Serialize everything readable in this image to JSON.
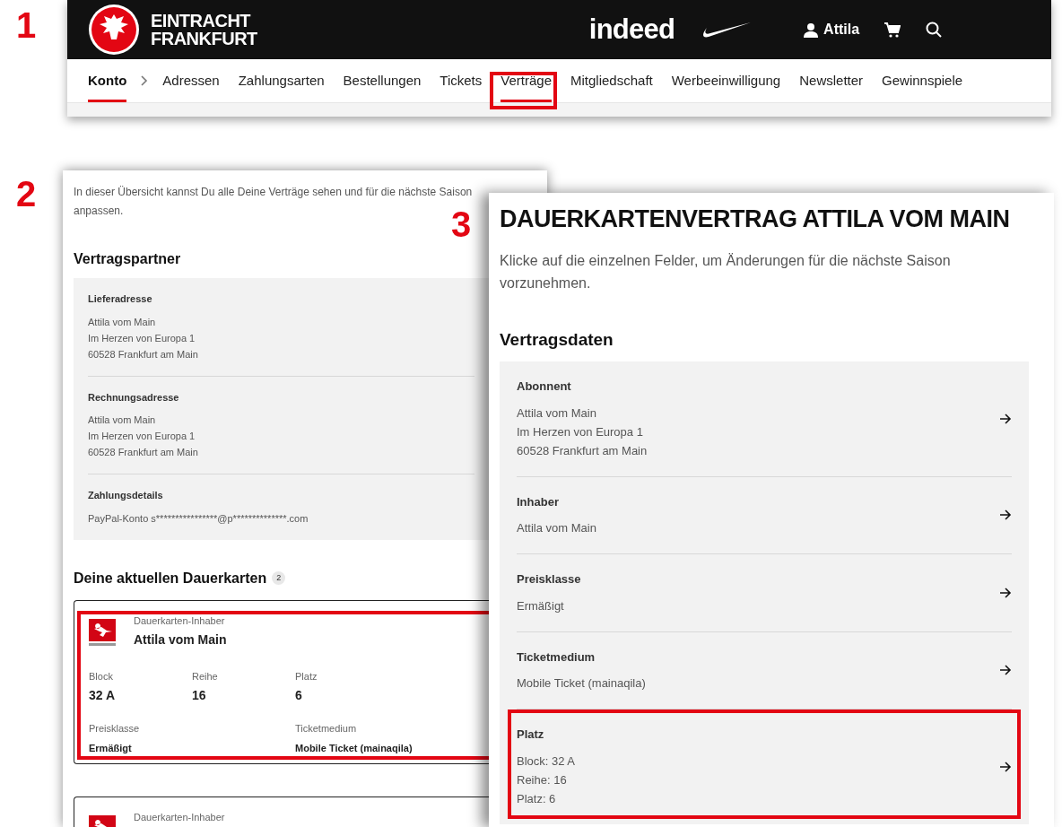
{
  "panel_1": {
    "step": "1",
    "header": {
      "brand": [
        "EINTRACHT",
        "FRANKFURT"
      ],
      "sponsor": "indeed",
      "user": "Attila"
    },
    "nav": {
      "root": "Konto",
      "items": [
        {
          "label": "Adressen",
          "selected": false,
          "highlighted": false
        },
        {
          "label": "Zahlungsarten",
          "selected": false,
          "highlighted": false
        },
        {
          "label": "Bestellungen",
          "selected": false,
          "highlighted": false
        },
        {
          "label": "Tickets",
          "selected": false,
          "highlighted": false
        },
        {
          "label": "Verträge",
          "selected": true,
          "highlighted": true
        },
        {
          "label": "Mitgliedschaft",
          "selected": false,
          "highlighted": false
        },
        {
          "label": "Werbeeinwilligung",
          "selected": false,
          "highlighted": false
        },
        {
          "label": "Newsletter",
          "selected": false,
          "highlighted": false
        },
        {
          "label": "Gewinnspiele",
          "selected": false,
          "highlighted": false
        }
      ]
    }
  },
  "panel_2": {
    "step": "2",
    "intro": "In dieser Übersicht kannst Du alle Deine Verträge sehen und für die nächste Saison anpassen.",
    "partner_title": "Vertragspartner",
    "partner_blocks": [
      {
        "title": "Lieferadresse",
        "lines": [
          "Attila vom Main",
          "Im Herzen von Europa 1",
          "60528 Frankfurt am Main"
        ]
      },
      {
        "title": "Rechnungsadresse",
        "lines": [
          "Attila vom Main",
          "Im Herzen von Europa 1",
          "60528 Frankfurt am Main"
        ]
      },
      {
        "title": "Zahlungsdetails",
        "lines": [
          "PayPal-Konto s****************@p**************.com"
        ]
      }
    ],
    "cards_title": "Deine aktuellen Dauerkarten",
    "cards_count": "2",
    "cards": [
      {
        "highlighted": true,
        "holder_label": "Dauerkarten-Inhaber",
        "holder_name": "Attila vom Main",
        "seat": [
          {
            "label": "Block",
            "value": "32 A"
          },
          {
            "label": "Reihe",
            "value": "16"
          },
          {
            "label": "Platz",
            "value": "6"
          }
        ],
        "details": [
          {
            "label": "Preisklasse",
            "value": "Ermäßigt"
          },
          {
            "label": "Ticketmedium",
            "value": "Mobile Ticket (mainaqila)"
          }
        ]
      },
      {
        "highlighted": false,
        "holder_label": "Dauerkarten-Inhaber"
      }
    ]
  },
  "panel_3": {
    "step": "3",
    "title": "DAUERKARTENVERTRAG ATTILA VOM MAIN",
    "intro": "Klicke auf die einzelnen Felder, um Änderungen für die nächste Saison vorzunehmen.",
    "section_title": "Vertragsdaten",
    "rows": [
      {
        "title": "Abonnent",
        "lines": [
          "Attila vom Main",
          "Im Herzen von Europa 1",
          "60528 Frankfurt am Main"
        ],
        "highlighted": false
      },
      {
        "title": "Inhaber",
        "lines": [
          "Attila vom Main"
        ],
        "highlighted": false
      },
      {
        "title": "Preisklasse",
        "lines": [
          "Ermäßigt"
        ],
        "highlighted": false
      },
      {
        "title": "Ticketmedium",
        "lines": [
          "Mobile Ticket (mainaqila)"
        ],
        "highlighted": false
      },
      {
        "title": "Platz",
        "lines": [
          "Block: 32 A",
          "Reihe: 16",
          "Platz: 6"
        ],
        "highlighted": true
      }
    ]
  }
}
